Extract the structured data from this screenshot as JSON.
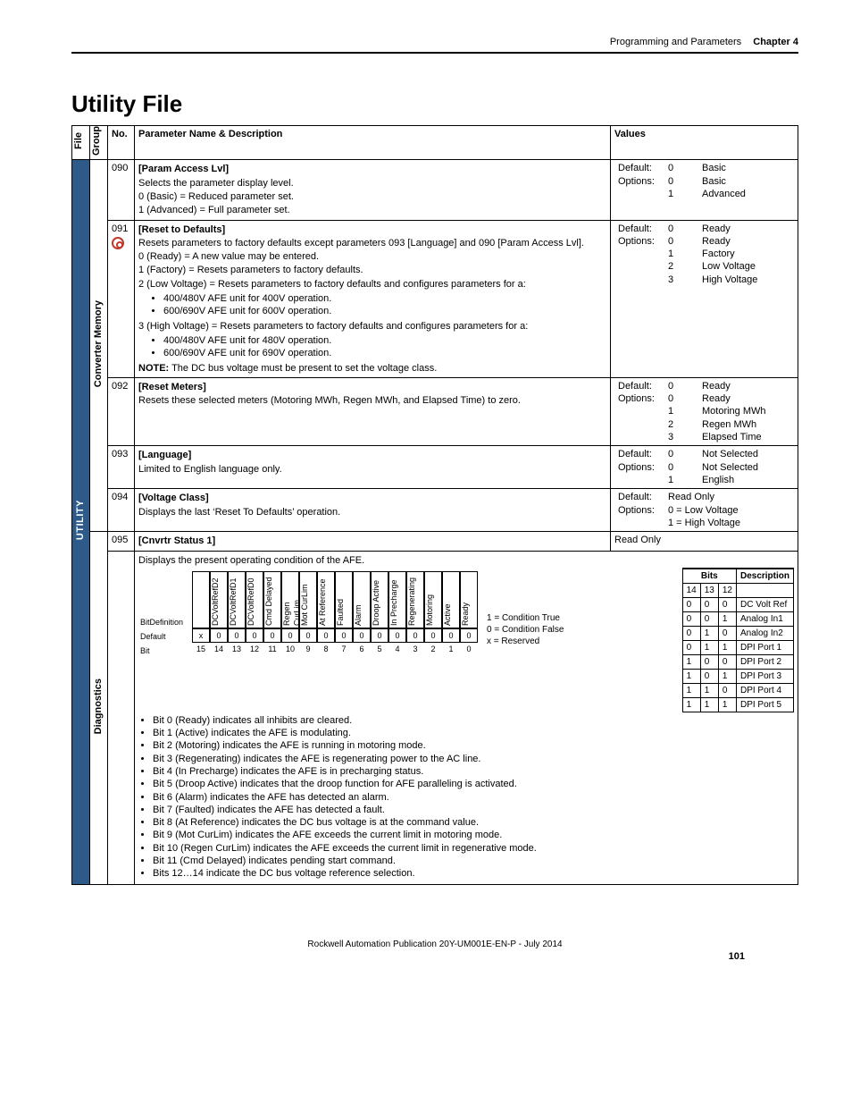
{
  "header": {
    "section": "Programming and Parameters",
    "chapter": "Chapter 4"
  },
  "title": "Utility File",
  "columns": {
    "file": "File",
    "group": "Group",
    "no": "No.",
    "param": "Parameter Name & Description",
    "values": "Values"
  },
  "fileBand": "UTILITY",
  "groups": {
    "convMem": "Converter Memory",
    "diag": "Diagnostics"
  },
  "labels": {
    "default": "Default:",
    "options": "Options:",
    "readonly": "Read Only"
  },
  "rows": {
    "r090": {
      "no": "090",
      "name": "[Param Access Lvl]",
      "p1": "Selects the parameter display level.",
      "p2": "0 (Basic) = Reduced parameter set.",
      "p3": "1 (Advanced) = Full parameter set.",
      "def": {
        "c": "0",
        "t": "Basic"
      },
      "opts": [
        {
          "c": "0",
          "t": "Basic"
        },
        {
          "c": "1",
          "t": "Advanced"
        }
      ]
    },
    "r091": {
      "no": "091",
      "name": "[Reset to Defaults]",
      "p1": "Resets parameters to factory defaults except parameters 093 [Language] and 090 [Param Access Lvl].",
      "p2": "0 (Ready) = A new value may be entered.",
      "p3": "1 (Factory) = Resets parameters to factory defaults.",
      "p4": "2 (Low Voltage) = Resets parameters to factory defaults and configures parameters for a:",
      "b4a": "400/480V AFE unit for 400V operation.",
      "b4b": "600/690V AFE unit for 600V operation.",
      "p5": "3 (High Voltage) = Resets parameters to factory defaults and configures parameters for a:",
      "b5a": "400/480V AFE unit for 480V operation.",
      "b5b": "600/690V AFE unit for 690V operation.",
      "noteLabel": "NOTE:",
      "note": " The DC bus voltage must be present to set the voltage class.",
      "def": {
        "c": "0",
        "t": "Ready"
      },
      "opts": [
        {
          "c": "0",
          "t": "Ready"
        },
        {
          "c": "1",
          "t": "Factory"
        },
        {
          "c": "2",
          "t": "Low Voltage"
        },
        {
          "c": "3",
          "t": "High Voltage"
        }
      ]
    },
    "r092": {
      "no": "092",
      "name": "[Reset Meters]",
      "p1": "Resets these selected meters (Motoring MWh, Regen MWh, and Elapsed Time) to zero.",
      "def": {
        "c": "0",
        "t": "Ready"
      },
      "opts": [
        {
          "c": "0",
          "t": "Ready"
        },
        {
          "c": "1",
          "t": "Motoring MWh"
        },
        {
          "c": "2",
          "t": "Regen MWh"
        },
        {
          "c": "3",
          "t": "Elapsed Time"
        }
      ]
    },
    "r093": {
      "no": "093",
      "name": "[Language]",
      "p1": "Limited to English language only.",
      "def": {
        "c": "0",
        "t": "Not Selected"
      },
      "opts": [
        {
          "c": "0",
          "t": "Not Selected"
        },
        {
          "c": "1",
          "t": "English"
        }
      ]
    },
    "r094": {
      "no": "094",
      "name": "[Voltage Class]",
      "p1": "Displays the last ‘Reset To Defaults’ operation.",
      "opts": [
        {
          "t": "0 = Low Voltage"
        },
        {
          "t": "1 = High Voltage"
        }
      ]
    },
    "r095": {
      "no": "095",
      "name": "[Cnvrtr Status 1]",
      "p1": "Displays the present operating condition of the AFE.",
      "bitLabel": "Bit",
      "bitDefLabel": "Definition",
      "defaultLabel": "Default",
      "bits": [
        "DCVoltRefD2",
        "DCVoltRefD1",
        "DCVoltRefD0",
        "Cmd Delayed",
        "Regen CurLim",
        "Mot CurLim",
        "At Reference",
        "Faulted",
        "Alarm",
        "Droop Active",
        "In Precharge",
        "Regenerating",
        "Motoring",
        "Active",
        "Ready"
      ],
      "bitNums": [
        "15",
        "14",
        "13",
        "12",
        "11",
        "10",
        "9",
        "8",
        "7",
        "6",
        "5",
        "4",
        "3",
        "2",
        "1",
        "0"
      ],
      "defaults": [
        "x",
        "0",
        "0",
        "0",
        "0",
        "0",
        "0",
        "0",
        "0",
        "0",
        "0",
        "0",
        "0",
        "0",
        "0",
        "0"
      ],
      "legend": {
        "a": "1 = Condition True",
        "b": "0 = Condition False",
        "c": "x = Reserved"
      },
      "explain": [
        "Bit 0 (Ready) indicates all inhibits are cleared.",
        "Bit 1 (Active) indicates the AFE is modulating.",
        "Bit 2 (Motoring) indicates the AFE is running in motoring mode.",
        "Bit 3 (Regenerating) indicates the AFE is regenerating power to the AC line.",
        "Bit 4 (In Precharge) indicates the AFE is in precharging status.",
        "Bit 5 (Droop Active) indicates that the droop function for AFE paralleling is activated.",
        "Bit 6 (Alarm) indicates the AFE has detected an alarm.",
        "Bit 7 (Faulted) indicates the AFE has detected a fault.",
        "Bit 8 (At Reference) indicates the DC bus voltage is at the command value.",
        "Bit 9 (Mot CurLim) indicates the AFE exceeds the current limit in motoring mode.",
        "Bit 10 (Regen CurLim) indicates the AFE exceeds the current limit in regenerative mode.",
        "Bit 11 (Cmd Delayed) indicates pending start command.",
        "Bits 12…14 indicate the DC bus voltage reference selection."
      ],
      "bitsHeader": {
        "bits": "Bits",
        "desc": "Description",
        "c14": "14",
        "c13": "13",
        "c12": "12"
      },
      "bitsTable": [
        {
          "a": "0",
          "b": "0",
          "c": "0",
          "d": "DC Volt Ref"
        },
        {
          "a": "0",
          "b": "0",
          "c": "1",
          "d": "Analog In1"
        },
        {
          "a": "0",
          "b": "1",
          "c": "0",
          "d": "Analog In2"
        },
        {
          "a": "0",
          "b": "1",
          "c": "1",
          "d": "DPI Port 1"
        },
        {
          "a": "1",
          "b": "0",
          "c": "0",
          "d": "DPI Port 2"
        },
        {
          "a": "1",
          "b": "0",
          "c": "1",
          "d": "DPI Port 3"
        },
        {
          "a": "1",
          "b": "1",
          "c": "0",
          "d": "DPI Port 4"
        },
        {
          "a": "1",
          "b": "1",
          "c": "1",
          "d": "DPI Port 5"
        }
      ]
    }
  },
  "footer": {
    "pub": "Rockwell Automation Publication 20Y-UM001E-EN-P - July 2014",
    "page": "101"
  }
}
